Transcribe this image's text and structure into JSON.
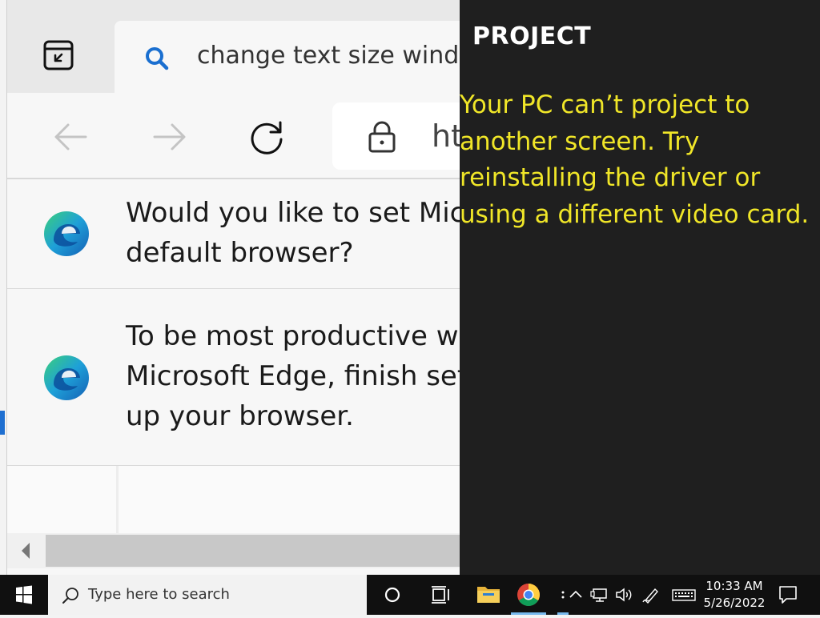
{
  "browser": {
    "tab_title": "change text size windo",
    "url_text": "ht",
    "notifications": [
      {
        "lines": [
          "Would you like to set Micr",
          "default browser?"
        ]
      },
      {
        "lines": [
          "To be most productive wit",
          "Microsoft Edge, finish sett",
          "up your browser."
        ]
      }
    ]
  },
  "project_panel": {
    "title": "PROJECT",
    "message_lines": [
      "Your PC can’t project to",
      "another screen. Try",
      "reinstalling the driver or",
      "using a different video card."
    ],
    "message_color": "#f0e628",
    "background": "#1f1f1f"
  },
  "taskbar": {
    "search_placeholder": "Type here to search",
    "time": "10:33 AM",
    "date": "5/26/2022",
    "pinned": [
      "cortana-icon",
      "task-view-icon",
      "file-explorer-icon",
      "chrome-icon"
    ],
    "tray": [
      "show-hidden-icons-icon",
      "network-icon",
      "volume-icon",
      "pen-icon",
      "keyboard-icon"
    ]
  }
}
